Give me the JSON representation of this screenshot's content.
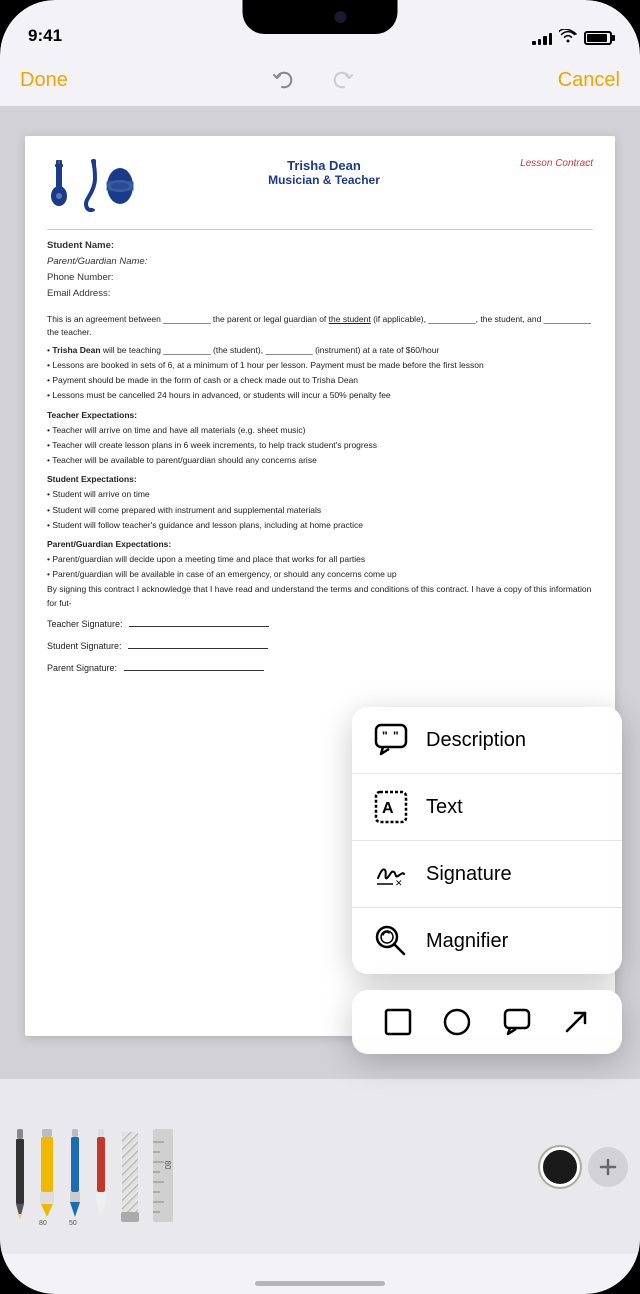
{
  "statusBar": {
    "time": "9:41",
    "signal": [
      3,
      5,
      7,
      9,
      11
    ],
    "battery": 90
  },
  "navbar": {
    "done": "Done",
    "cancel": "Cancel"
  },
  "document": {
    "header": {
      "name": "Trisha Dean",
      "subtitle": "Musician & Teacher",
      "contractLabel": "Lesson Contract"
    },
    "fields": {
      "studentName": "Student Name:",
      "parentName": "Parent/Guardian Name:",
      "phone": "Phone Number:",
      "email": "Email Address:"
    },
    "body": {
      "agreement": "This is an agreement between __________ the parent or legal guardian of the student (if applicable), __________, the student, and __________ the teacher.",
      "bullets": [
        "Trisha Dean will be teaching __________ (the student), __________ (instrument) at a rate of $60/hour",
        "Lessons are booked in sets of 6, at a minimum of 1 hour per lesson. Payment must be made before the first lesson",
        "Payment should be made in the form of cash or a check made out to Trisha Dean",
        "Lessons must be cancelled 24 hours in advanced, or students will incur a 50% penalty fee"
      ],
      "teacherExpTitle": "Teacher Expectations:",
      "teacherExp": [
        "Teacher will arrive on time and have all materials (e.g. sheet music)",
        "Teacher will create lesson plans in 6 week increments, to help track student's progress",
        "Teacher will be available to parent/guardian should any concerns arise"
      ],
      "studentExpTitle": "Student Expectations:",
      "studentExp": [
        "Student will arrive on time",
        "Student will come prepared with instrument and supplemental materials",
        "Student will follow teacher's guidance and lesson plans, including at home practice"
      ],
      "parentExpTitle": "Parent/Guardian Expectations:",
      "parentExp": [
        "Parent/guardian will decide upon a meeting time and place that works for all parties",
        "Parent/guardian will be available in case of an emergency, or should any concerns come up"
      ],
      "closing": "By signing this contract I acknowledge that I have read and understand the terms and conditions of this contract. I have a copy of this information for fut-"
    },
    "signatures": {
      "teacher": "Teacher Signature:",
      "student": "Student Signature:",
      "parent": "Parent Signature:"
    }
  },
  "popup": {
    "items": [
      {
        "id": "description",
        "label": "Description",
        "icon": "speech-bubble-icon"
      },
      {
        "id": "text",
        "label": "Text",
        "icon": "text-box-icon"
      },
      {
        "id": "signature",
        "label": "Signature",
        "icon": "signature-icon"
      },
      {
        "id": "magnifier",
        "label": "Magnifier",
        "icon": "magnifier-icon"
      }
    ],
    "shapes": [
      "square",
      "circle",
      "speech",
      "arrow"
    ]
  },
  "toolbar": {
    "tools": [
      "pencil",
      "yellow-highlighter",
      "blue-pen",
      "red-pen",
      "eraser",
      "ruler"
    ],
    "rulerLabel": "80",
    "penLabel": "50",
    "colorLabel": "color-picker",
    "addLabel": "+"
  }
}
